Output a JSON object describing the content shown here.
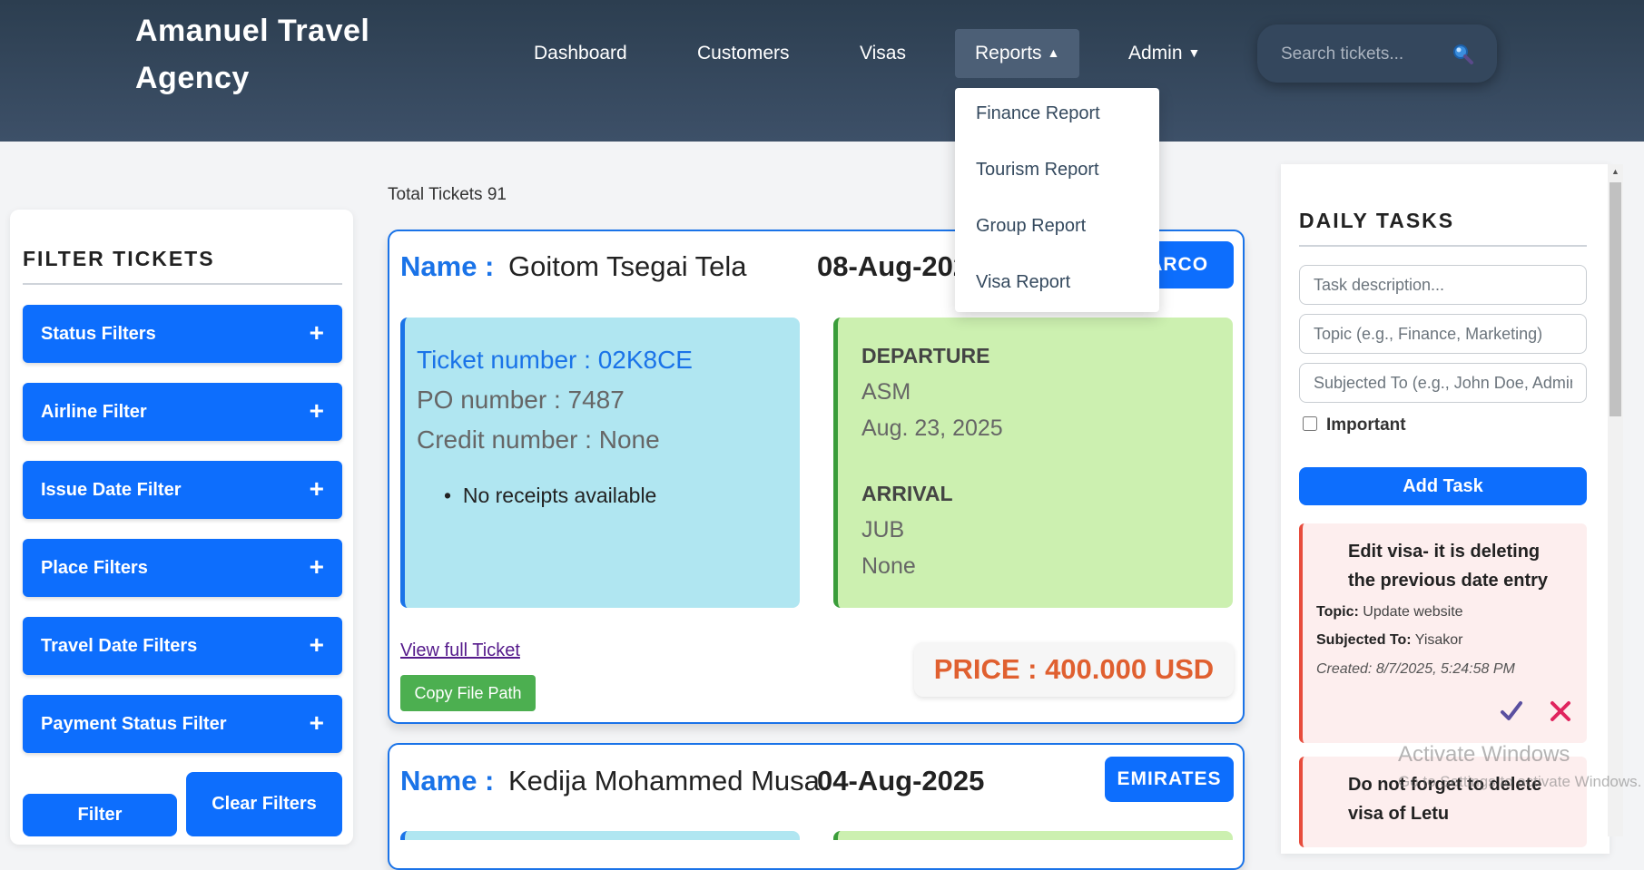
{
  "header": {
    "brand": "Amanuel Travel Agency",
    "nav": {
      "dashboard": "Dashboard",
      "customers": "Customers",
      "visas": "Visas",
      "reports": "Reports",
      "reports_caret": "▲",
      "admin": "Admin",
      "admin_caret": "▼"
    },
    "search_placeholder": "Search tickets..."
  },
  "reports_menu": [
    "Finance Report",
    "Tourism Report",
    "Group Report",
    "Visa Report"
  ],
  "filters": {
    "title": "FILTER TICKETS",
    "items": [
      "Status Filters",
      "Airline Filter",
      "Issue Date Filter",
      "Place Filters",
      "Travel Date Filters",
      "Payment Status Filter"
    ],
    "plus": "+",
    "filter_button": "Filter",
    "clear_button": "Clear Filters"
  },
  "main": {
    "total_label": "Total Tickets 91",
    "tickets": [
      {
        "name_label": "Name :",
        "name": "Goitom Tsegai Tela",
        "date": "08-Aug-2025",
        "airline": "STARCO",
        "ticket_number": "Ticket number : 02K8CE",
        "po_number": "PO number : 7487",
        "credit_number": "Credit number : None",
        "receipts": "No receipts available",
        "departure_label": "DEPARTURE",
        "departure_place": "ASM",
        "departure_date": "Aug. 23, 2025",
        "arrival_label": "ARRIVAL",
        "arrival_place": "JUB",
        "arrival_date": "None",
        "view_link": "View full Ticket",
        "copy_button": "Copy File Path",
        "price": "PRICE : 400.000 USD"
      },
      {
        "name_label": "Name :",
        "name": "Kedija Mohammed Musa",
        "date": "04-Aug-2025",
        "airline": "EMIRATES"
      }
    ]
  },
  "tasks": {
    "title": "DAILY TASKS",
    "description_placeholder": "Task description...",
    "topic_placeholder": "Topic (e.g., Finance, Marketing)",
    "subject_placeholder": "Subjected To (e.g., John Doe, Admin)",
    "important_label": "Important",
    "add_button": "Add Task",
    "items": [
      {
        "title": "Edit visa- it is deleting the previous date entry",
        "topic_label": "Topic:",
        "topic": "Update website",
        "subject_label": "Subjected To:",
        "subject": "Yisakor",
        "created": "Created: 8/7/2025, 5:24:58 PM"
      },
      {
        "title": "Do not forget to delete visa of Letu"
      }
    ]
  },
  "overlay": {
    "activate_title": "Activate Windows",
    "activate_sub": "Go to Settings to activate Windows."
  }
}
